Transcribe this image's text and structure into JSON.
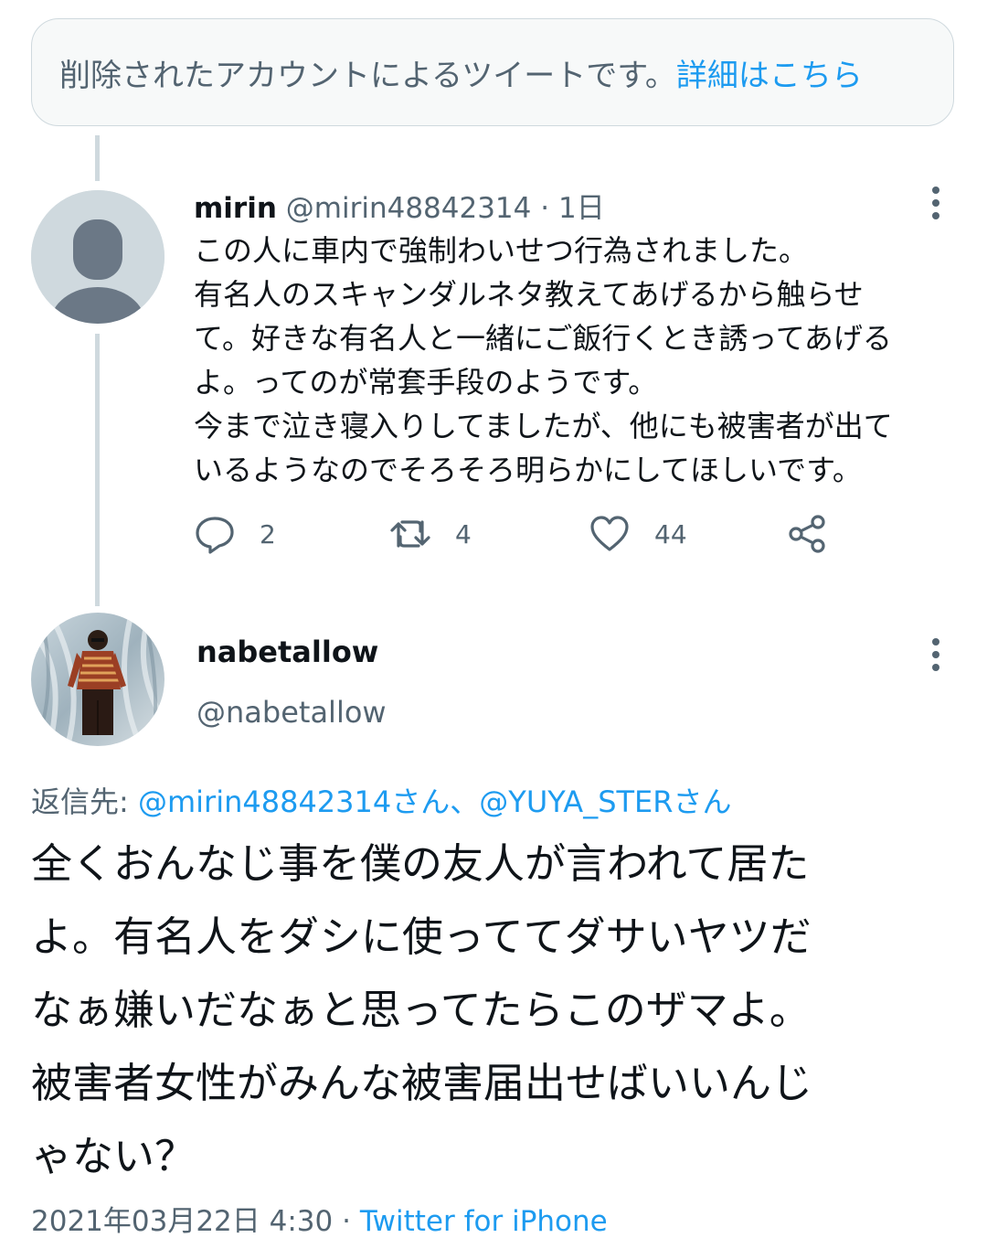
{
  "notice": {
    "text": "削除されたアカウントによるツイートです。",
    "link": "詳細はこちら"
  },
  "tweet1": {
    "name": "mirin",
    "handle": "@mirin48842314",
    "dot": "·",
    "time": "1日",
    "lines": [
      "この人に車内で強制わいせつ行為されました。",
      "有名人のスキャンダルネタ教えてあげるから触らせ",
      "て。好きな有名人と一緒にご飯行くとき誘ってあげる",
      "よ。ってのが常套手段のようです。",
      "今まで泣き寝入りしてましたが、他にも被害者が出て",
      "いるようなのでそろそろ明らかにしてほしいです。"
    ],
    "replies": "2",
    "retweets": "4",
    "likes": "44"
  },
  "tweet2": {
    "name": "nabetallow",
    "handle": "@nabetallow",
    "reply_label": "返信先:",
    "mention1": "@mirin48842314さん",
    "separator": "、",
    "mention2": "@YUYA_STERさん",
    "lines": [
      "全くおんなじ事を僕の友人が言われて居た",
      "よ。有名人をダシに使っててダサいヤツだ",
      "なぁ嫌いだなぁと思ってたらこのザマよ。",
      "被害者女性がみんな被害届出せばいいんじ",
      "ゃない？"
    ],
    "date": "2021年03月22日 4:30",
    "dot": "·",
    "source": "Twitter for iPhone"
  },
  "colors": {
    "accent": "#1d9bf0",
    "muted": "#536471",
    "line": "#cfd9de"
  },
  "icons": [
    "more-icon",
    "reply-icon",
    "retweet-icon",
    "like-icon",
    "share-icon",
    "default-avatar-icon"
  ]
}
